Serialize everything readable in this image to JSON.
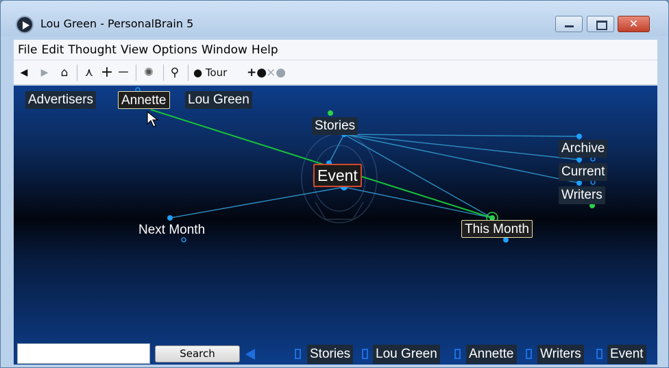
{
  "window": {
    "title": "Lou Green - PersonalBrain 5",
    "controls": {
      "close": "✕"
    }
  },
  "menu": [
    "File",
    "Edit",
    "Thought",
    "View",
    "Options",
    "Window",
    "Help"
  ],
  "toolbar": {
    "tour_label": "Tour",
    "buttons": [
      "back-icon",
      "forward-icon",
      "home-icon",
      "network-icon",
      "zoom-in-icon",
      "zoom-out-icon",
      "brain-icon",
      "search-icon",
      "tour-icon",
      "add-icon",
      "remove-icon"
    ]
  },
  "plex": {
    "parents": [
      "Advertisers",
      "Annette",
      "Lou Green"
    ],
    "thoughts": {
      "stories": "Stories",
      "event": "Event",
      "archive": "Archive",
      "current": "Current",
      "writers": "Writers",
      "next_month": "Next Month",
      "this_month": "This Month"
    }
  },
  "search": {
    "input_value": "",
    "button_label": "Search"
  },
  "pins": [
    "Stories",
    "Lou Green",
    "Annette",
    "Writers",
    "Event"
  ]
}
